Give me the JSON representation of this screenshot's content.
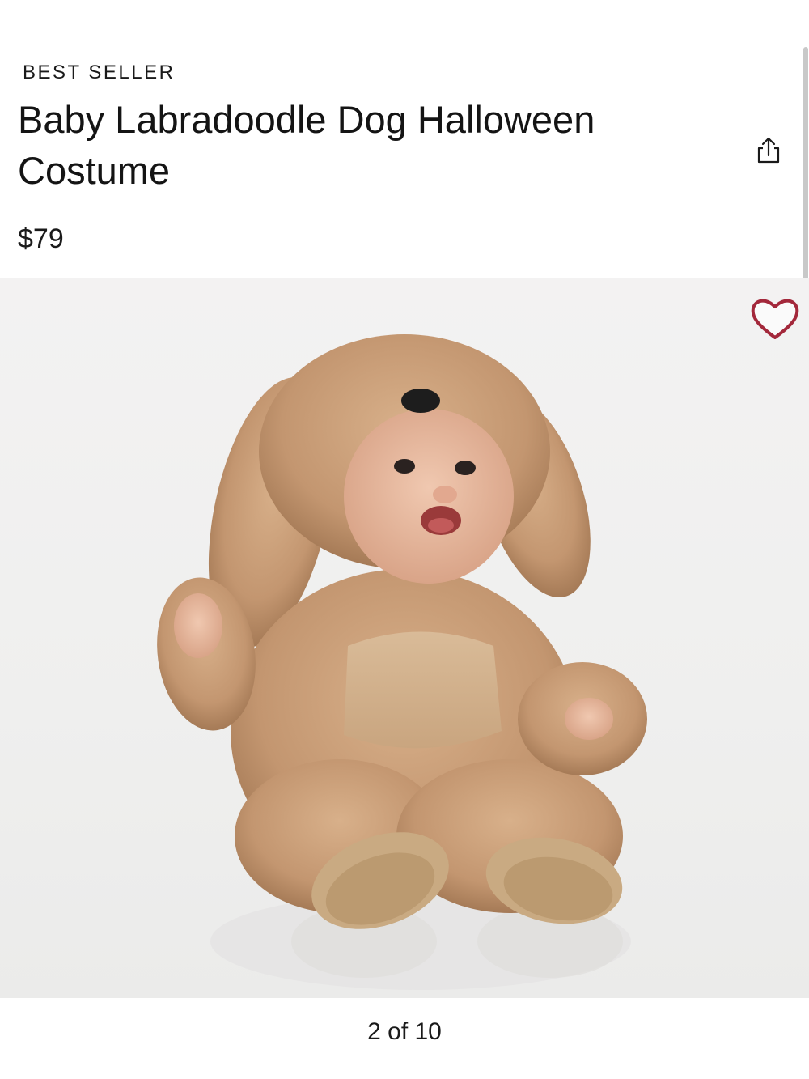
{
  "product": {
    "badge": "BEST SELLER",
    "title": "Baby Labradoodle Dog Halloween Costume",
    "price": "$79"
  },
  "actions": {
    "share_icon": "share-icon",
    "wishlist_icon": "heart-icon"
  },
  "gallery": {
    "pager_text": "2 of 10",
    "current": 2,
    "total": 10
  },
  "colors": {
    "wishlist_accent": "#a3283b",
    "text": "#1a1a1a",
    "background": "#ffffff"
  }
}
